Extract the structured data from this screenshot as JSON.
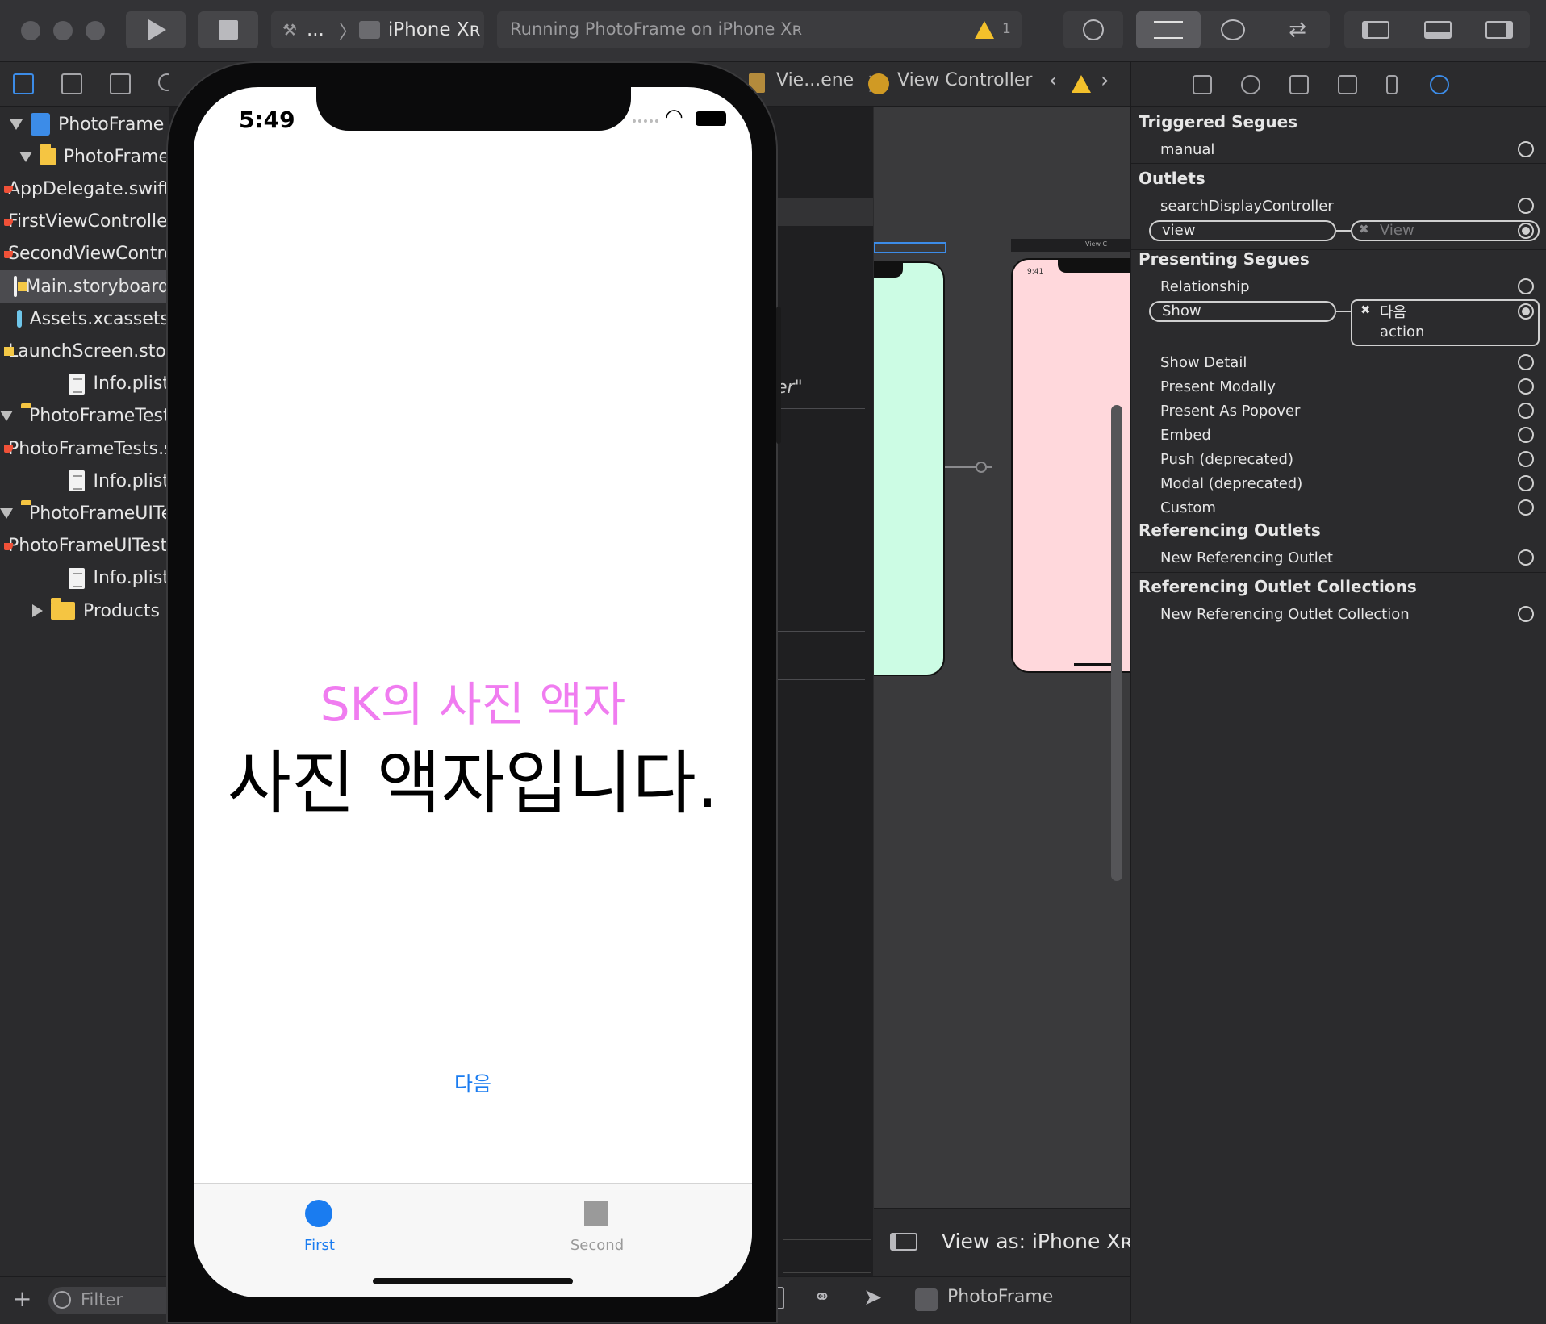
{
  "toolbar": {
    "scheme_project": "...",
    "scheme_device": "iPhone Xʀ",
    "status_text": "Running PhotoFrame on iPhone Xʀ",
    "warning_count": "1"
  },
  "navigator": {
    "items": [
      {
        "label": "PhotoFrame",
        "kind": "project",
        "depth": 0,
        "disclosure": "open"
      },
      {
        "label": "PhotoFrame",
        "kind": "folder",
        "depth": 1,
        "disclosure": "open"
      },
      {
        "label": "AppDelegate.swift",
        "kind": "swift",
        "depth": 2
      },
      {
        "label": "FirstViewController.swift",
        "kind": "swift",
        "depth": 2
      },
      {
        "label": "SecondViewController.swift",
        "kind": "swift",
        "depth": 2
      },
      {
        "label": "Main.storyboard",
        "kind": "storyboard",
        "depth": 2,
        "selected": true
      },
      {
        "label": "Assets.xcassets",
        "kind": "assets",
        "depth": 2
      },
      {
        "label": "LaunchScreen.storyboard",
        "kind": "storyboard",
        "depth": 2
      },
      {
        "label": "Info.plist",
        "kind": "plist",
        "depth": 2
      },
      {
        "label": "PhotoFrameTests",
        "kind": "folder",
        "depth": 1,
        "disclosure": "open"
      },
      {
        "label": "PhotoFrameTests.swift",
        "kind": "swift",
        "depth": 2
      },
      {
        "label": "Info.plist",
        "kind": "plist",
        "depth": 2
      },
      {
        "label": "PhotoFrameUITests",
        "kind": "folder",
        "depth": 1,
        "disclosure": "open"
      },
      {
        "label": "PhotoFrameUITests.swift",
        "kind": "swift",
        "depth": 2
      },
      {
        "label": "Info.plist",
        "kind": "plist",
        "depth": 2
      },
      {
        "label": "Products",
        "kind": "folder",
        "depth": 1,
        "disclosure": "closed"
      }
    ],
    "filter_placeholder": "Filter"
  },
  "jumpbar": {
    "scene": "Vie...ene",
    "controller": "View Controller"
  },
  "outline": {
    "partial_text": "er\""
  },
  "canvas": {
    "second_scene_title": "View C",
    "second_scene_time": "9:41",
    "view_as": "View as: iPhone Xʀ"
  },
  "debug": {
    "target": "PhotoFrame"
  },
  "inspector": {
    "triggered_segues": {
      "title": "Triggered Segues",
      "rows": [
        "manual"
      ]
    },
    "outlets": {
      "title": "Outlets",
      "rows": [
        "searchDisplayController",
        "view"
      ],
      "view_target": "View"
    },
    "presenting_segues": {
      "title": "Presenting Segues",
      "rows": [
        "Relationship",
        "Show",
        "Show Detail",
        "Present Modally",
        "Present As Popover",
        "Embed",
        "Push (deprecated)",
        "Modal (deprecated)",
        "Custom"
      ],
      "show_target_name": "다음",
      "show_target_action": "action"
    },
    "referencing_outlets": {
      "title": "Referencing Outlets",
      "rows": [
        "New Referencing Outlet"
      ]
    },
    "referencing_collections": {
      "title": "Referencing Outlet Collections",
      "rows": [
        "New Referencing Outlet Collection"
      ]
    }
  },
  "simulator": {
    "time": "5:49",
    "app_subtitle": "SK의 사진 액자",
    "app_title": "사진 액자입니다.",
    "next_button": "다음",
    "tabs": [
      {
        "label": "First",
        "active": true
      },
      {
        "label": "Second",
        "active": false
      }
    ],
    "colors": {
      "subtitle": "#f07cf0",
      "accent": "#1a7cf0",
      "tab_inactive": "#9a9a9a",
      "scene1_bg": "#ccfce4",
      "scene2_bg": "#ffd8dc"
    }
  }
}
